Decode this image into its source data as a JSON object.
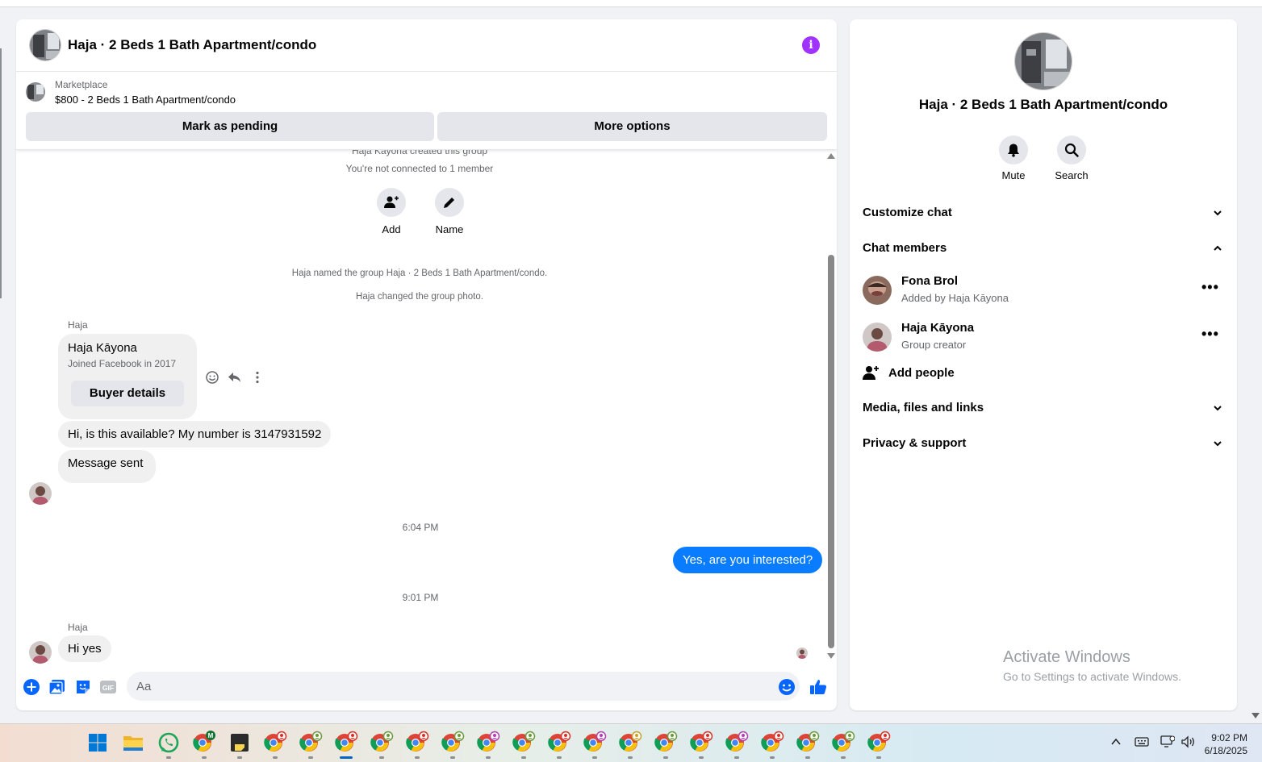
{
  "chat": {
    "title": "Haja · 2 Beds 1 Bath Apartment/condo",
    "info_icon": "i",
    "marketplace_label": "Marketplace",
    "listing": "$800 - 2 Beds 1 Bath Apartment/condo",
    "mark_pending": "Mark as pending",
    "more_options": "More options"
  },
  "messages": {
    "created": "Haja Kāyona created this group",
    "not_connected": "You're not connected to 1 member",
    "add_label": "Add",
    "name_label": "Name",
    "named_group": "Haja named the group Haja · 2 Beds 1 Bath Apartment/condo.",
    "changed_photo": "Haja changed the group photo.",
    "sender1": "Haja",
    "card_name": "Haja Kāyona",
    "card_joined": "Joined Facebook in 2017",
    "buyer_details": "Buyer details",
    "msg1": "Hi, is this available? My number is 3147931592",
    "msg2": "Message sent",
    "time1": "6:04 PM",
    "out1": "Yes, are you interested?",
    "time2": "9:01 PM",
    "sender2": "Haja",
    "msg3": "Hi yes"
  },
  "composer": {
    "placeholder": "Aa",
    "gif": "GIF"
  },
  "side": {
    "title": "Haja · 2 Beds 1 Bath Apartment/condo",
    "mute": "Mute",
    "search": "Search",
    "customize": "Customize chat",
    "members_header": "Chat members",
    "members": [
      {
        "name": "Fona Brol",
        "sub": "Added by Haja Kāyona",
        "more": "•••"
      },
      {
        "name": "Haja Kāyona",
        "sub": "Group creator",
        "more": "•••"
      }
    ],
    "add_people": "Add people",
    "media": "Media, files and links",
    "privacy": "Privacy & support"
  },
  "watermark": {
    "line1": "Activate Windows",
    "line2": "Go to Settings to activate Windows."
  },
  "taskbar": {
    "time": "9:02 PM",
    "date": "6/18/2025",
    "whatsapp_badge": "M"
  },
  "colors": {
    "accent": "#0a7cff",
    "info": "#a033ff",
    "messenger_blue": "#0866ff"
  }
}
